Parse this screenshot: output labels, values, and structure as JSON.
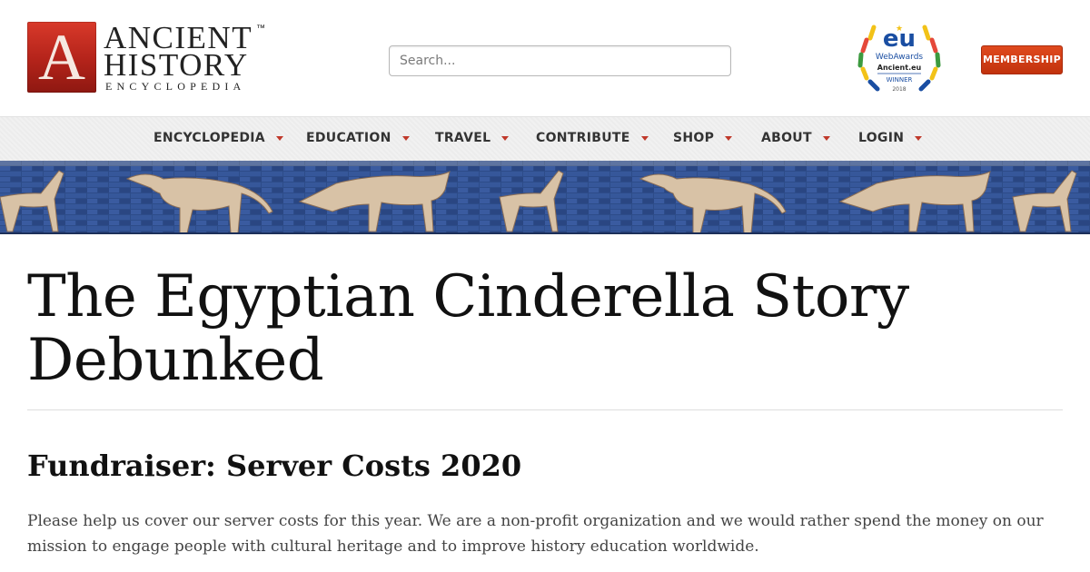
{
  "logo": {
    "letter": "A",
    "line1": "ANCIENT",
    "line2": "HISTORY",
    "line3": "ENCYCLOPEDIA",
    "tm": "™",
    "brand_color": "#c0281d"
  },
  "search": {
    "placeholder": "Search..."
  },
  "award": {
    "eu": "eu",
    "line1": "WebAwards",
    "line2": "Ancient.eu",
    "line3": "WINNER",
    "year": "2018"
  },
  "membership": {
    "label": "MEMBERSHIP",
    "color": "#d03b14"
  },
  "nav": {
    "items": [
      {
        "label": "ENCYCLOPEDIA",
        "icon": "caret-down-icon"
      },
      {
        "label": "EDUCATION",
        "icon": "caret-down-icon"
      },
      {
        "label": "TRAVEL",
        "icon": "caret-down-icon"
      },
      {
        "label": "CONTRIBUTE",
        "icon": "caret-down-icon"
      },
      {
        "label": "SHOP",
        "icon": "caret-down-icon"
      },
      {
        "label": "ABOUT",
        "icon": "caret-down-icon"
      },
      {
        "label": "LOGIN",
        "icon": "caret-down-icon"
      }
    ],
    "caret_color": "#c0392b"
  },
  "banner": {
    "description_icon": "ishtar-gate-lions-banner",
    "brick_color": "#2c4a86"
  },
  "article": {
    "title": "The Egyptian Cinderella Story Debunked"
  },
  "fundraiser": {
    "heading": "Fundraiser: Server Costs 2020",
    "text": "Please help us cover our server costs for this year. We are a non-profit organization and we would rather spend the money on our mission to engage people with cultural heritage and to improve history education worldwide."
  }
}
